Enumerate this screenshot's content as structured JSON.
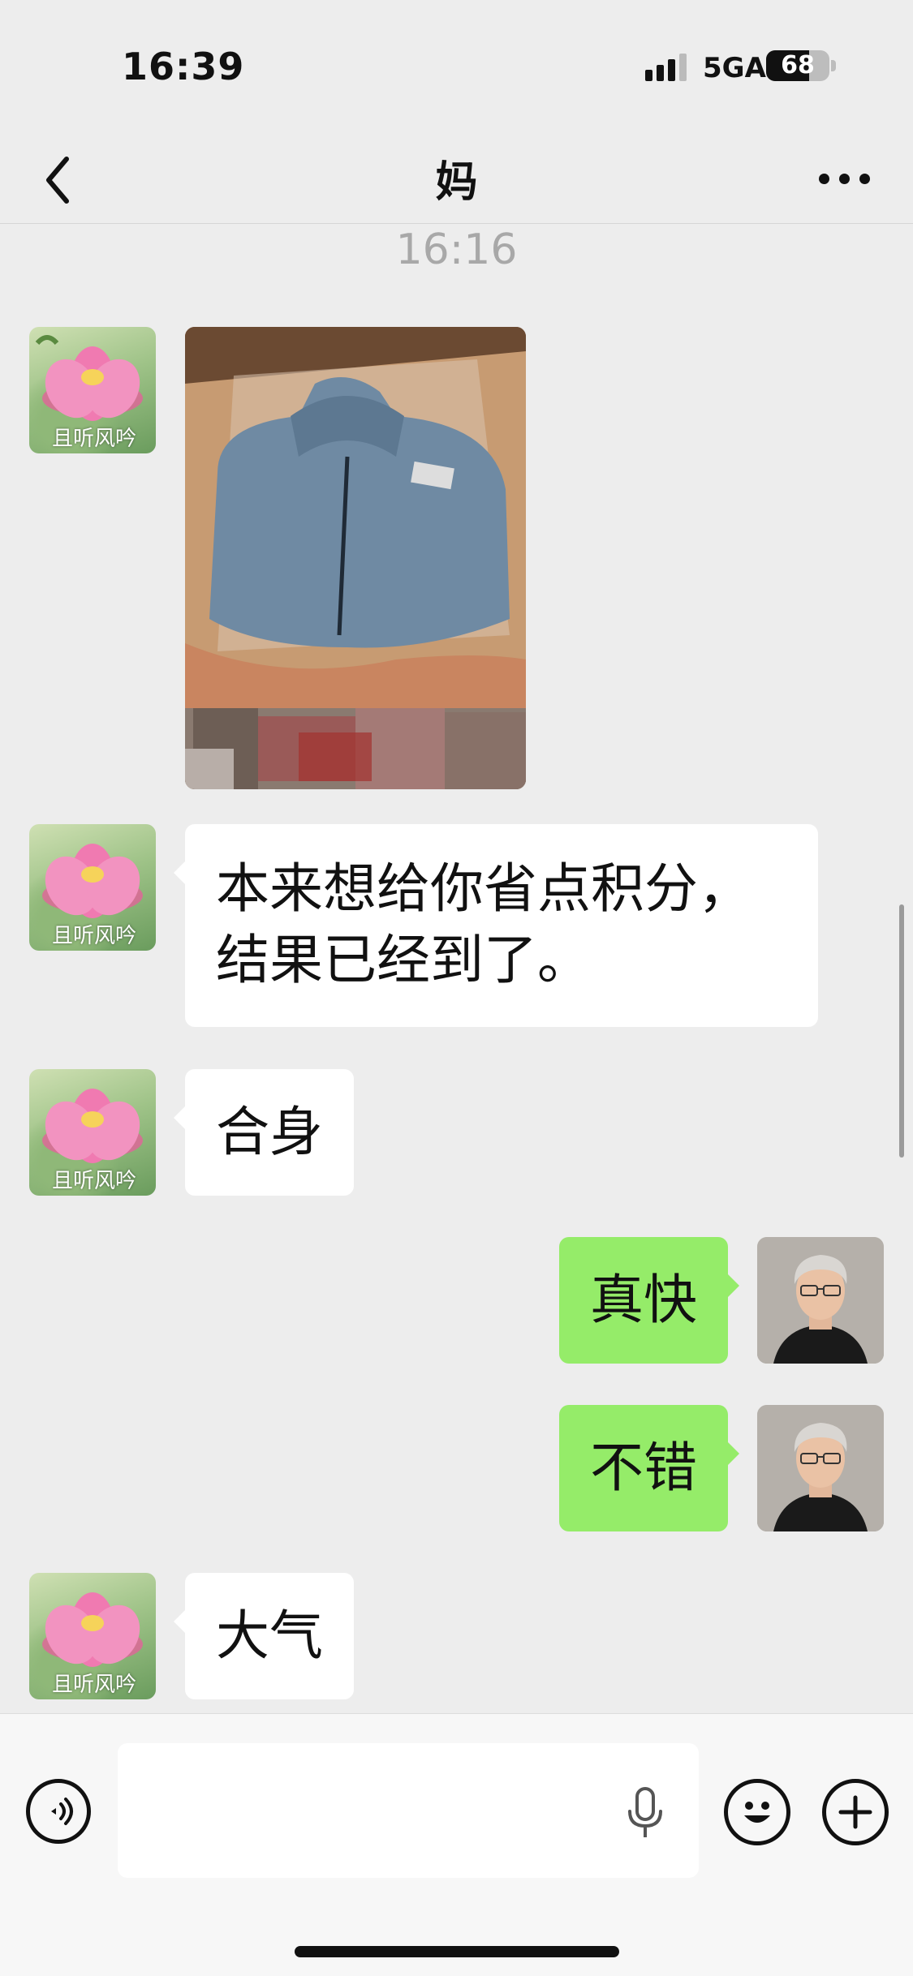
{
  "status_bar": {
    "time": "16:39",
    "network": "5GA",
    "battery_percent": "68",
    "battery_level": 0.68,
    "signal_bars": 3
  },
  "nav": {
    "title": "妈",
    "back_icon": "chevron-left-icon",
    "more_icon": "ellipsis-icon"
  },
  "chat": {
    "timestamp": "16:16",
    "contact_avatar_caption": "且听风吟",
    "messages": [
      {
        "side": "left",
        "type": "image",
        "content": "jacket photo"
      },
      {
        "side": "left",
        "type": "text",
        "lines": [
          "本来想给你省点积分，",
          "结果已经到了。"
        ]
      },
      {
        "side": "left",
        "type": "text",
        "text": "合身"
      },
      {
        "side": "right",
        "type": "text",
        "text": "真快"
      },
      {
        "side": "right",
        "type": "text",
        "text": "不错"
      },
      {
        "side": "left",
        "type": "text",
        "text": "大气"
      }
    ]
  },
  "input_bar": {
    "placeholder": "",
    "voice_icon": "voice-mode-icon",
    "mic_icon": "microphone-icon",
    "emoji_icon": "emoji-icon",
    "plus_icon": "plus-icon"
  },
  "colors": {
    "background": "#ededed",
    "bubble_self": "#95ec69",
    "bubble_other": "#ffffff",
    "timestamp": "#a8a8a8"
  }
}
